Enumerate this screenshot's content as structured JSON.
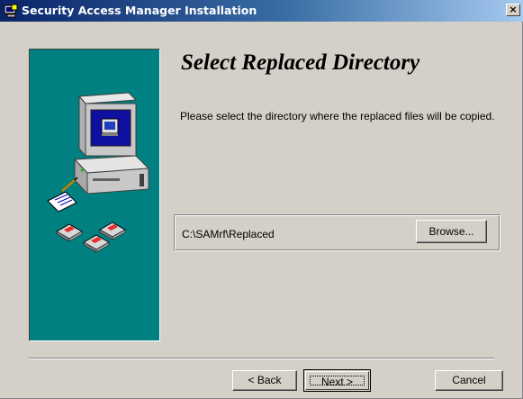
{
  "window": {
    "title": "Security Access Manager Installation",
    "close_glyph": "×",
    "icon": "installer-icon"
  },
  "main": {
    "heading": "Select Replaced Directory",
    "instruction": "Please select the directory where the replaced  files will be copied.",
    "directory": {
      "path": "C:\\SAMrf\\Replaced",
      "browse_label": "Browse..."
    }
  },
  "footer": {
    "back_label": "< Back",
    "next_label": "Next >",
    "cancel_label": "Cancel"
  },
  "illustration": {
    "icon": "computer-with-disks-illustration",
    "background_color": "#008080"
  }
}
